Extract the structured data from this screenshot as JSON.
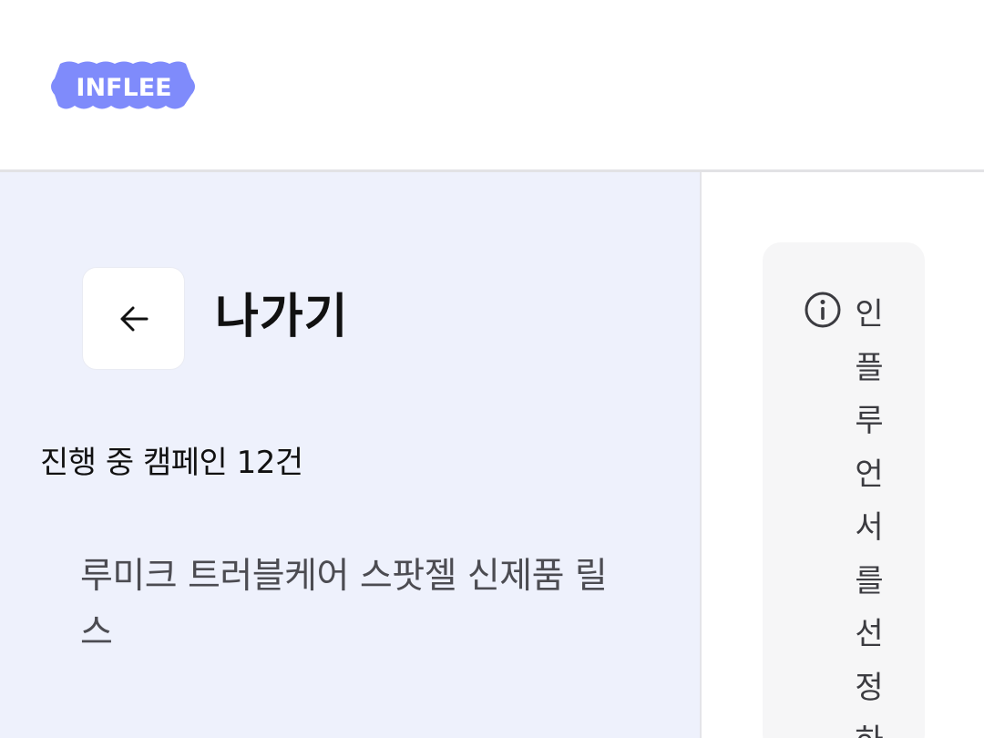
{
  "header": {
    "logo_text": "INFLEE",
    "logo_color": "#7f8bfb"
  },
  "sidebar": {
    "back_icon": "arrow-left-icon",
    "back_label": "나가기",
    "campaign_count": "진행 중 캠페인 12건",
    "campaigns": [
      {
        "title": "루미크 트러블케어 스팟젤 신제품 릴스"
      }
    ]
  },
  "main": {
    "notice_icon": "info-icon",
    "notice_text": "인플루언서를선정하"
  },
  "colors": {
    "sidebar_background": "#eef1fc",
    "notice_background": "#f6f6f7"
  }
}
